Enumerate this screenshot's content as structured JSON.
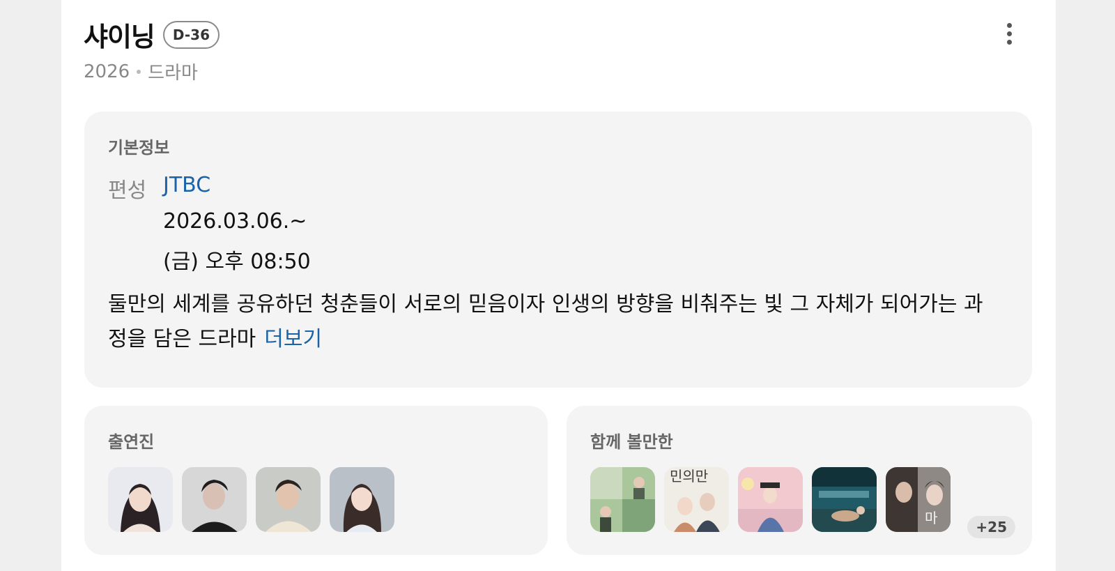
{
  "header": {
    "title": "샤이닝",
    "dday": "D-36",
    "year": "2026",
    "genre": "드라마"
  },
  "info": {
    "section_title": "기본정보",
    "broadcast_label": "편성",
    "network": "JTBC",
    "date": "2026.03.06.~",
    "time": "(금) 오후 08:50",
    "synopsis": "둘만의 세계를 공유하던 청춘들이 서로의 믿음이자 인생의 방향을 비춰주는 빛 그 자체가 되어가는 과정을 담은 드라마",
    "more_label": "더보기"
  },
  "cast": {
    "section_title": "출연진"
  },
  "recommendations": {
    "section_title": "함께 볼만한",
    "more_count": "+25",
    "poster_texts": [
      "민의만",
      "마"
    ]
  },
  "colors": {
    "link": "#1a63a8",
    "card_bg": "#f4f4f4",
    "page_bg": "#efefef"
  },
  "icons": [
    "more-vertical-icon"
  ]
}
